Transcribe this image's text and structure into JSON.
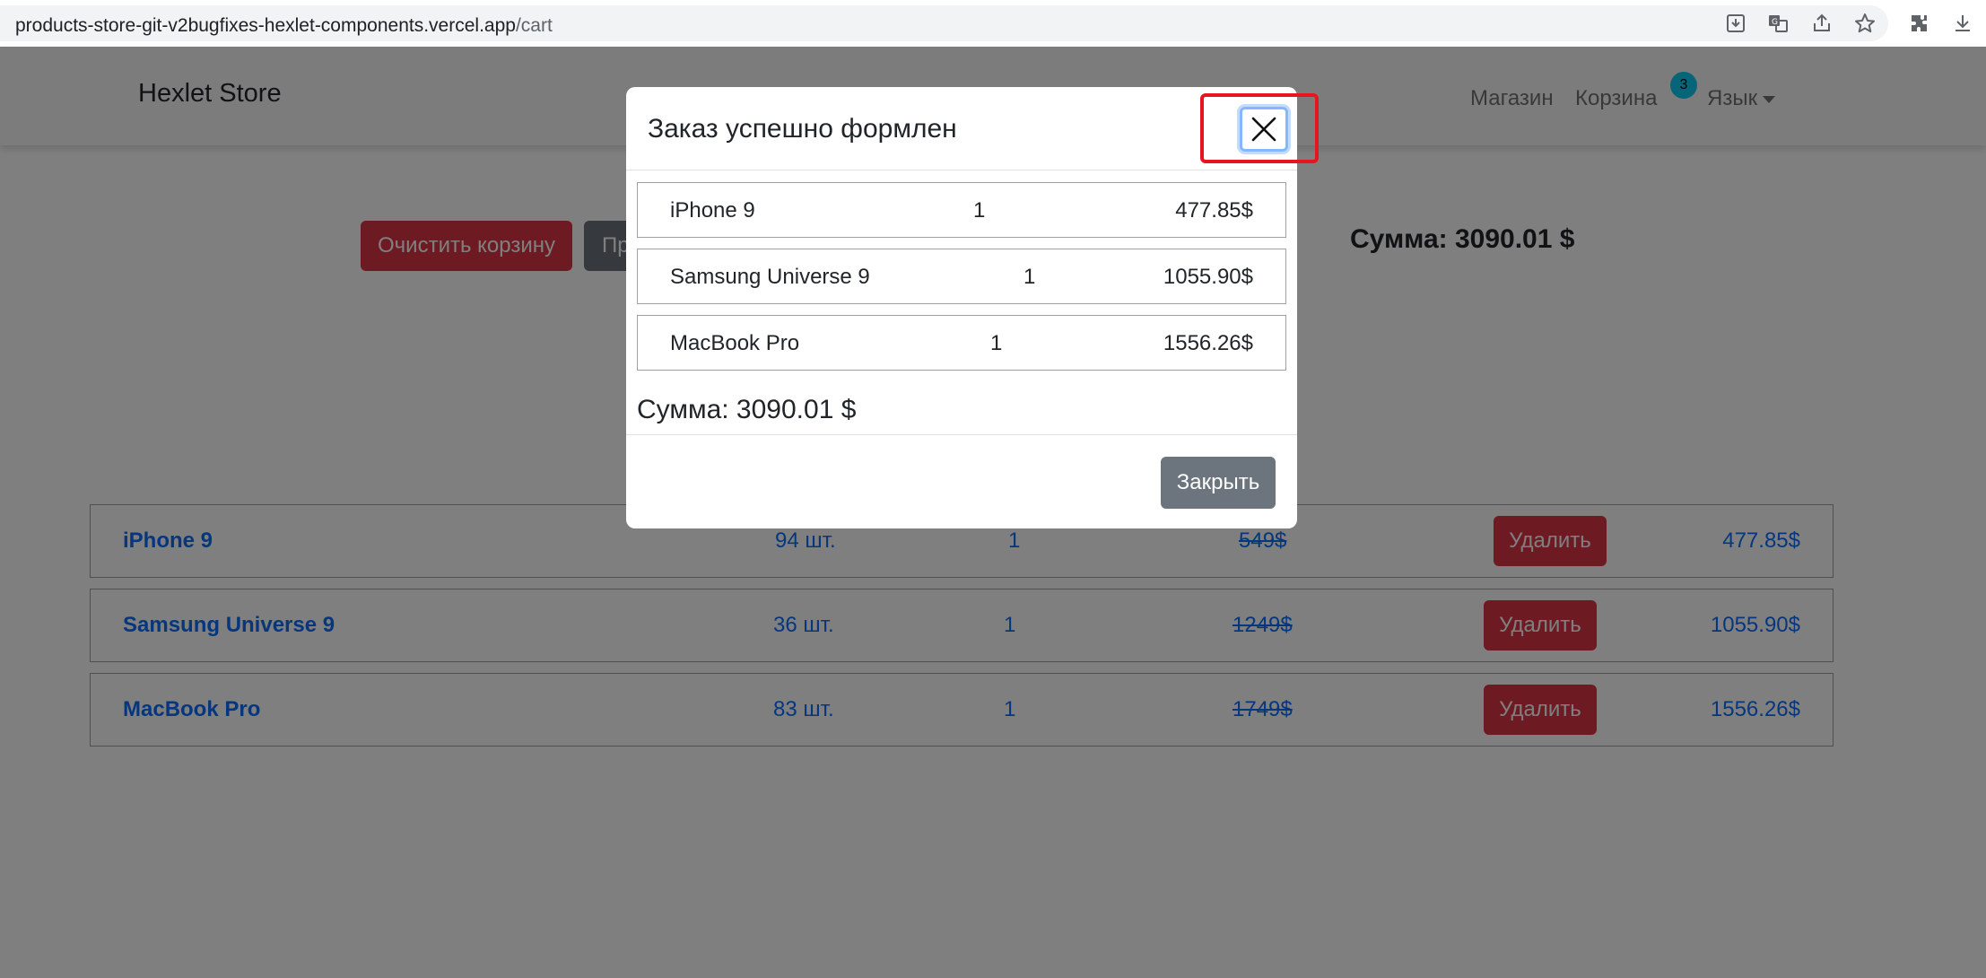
{
  "browser": {
    "url_host": "products-store-git-v2bugfixes-hexlet-components.vercel.app",
    "url_path": "/cart"
  },
  "navbar": {
    "brand": "Hexlet Store",
    "shop": "Магазин",
    "cart": "Корзина",
    "cart_count": "3",
    "language": "Язык"
  },
  "cart": {
    "clear_label": "Очистить корзину",
    "order_label_visible": "Пр",
    "total": "Сумма: 3090.01 $",
    "delete_label": "Удалить",
    "items": [
      {
        "name": "iPhone 9",
        "stock": "94 шт.",
        "qty": "1",
        "old_price": "549$",
        "price": "477.85$"
      },
      {
        "name": "Samsung Universe 9",
        "stock": "36 шт.",
        "qty": "1",
        "old_price": "1249$",
        "price": "1055.90$"
      },
      {
        "name": "MacBook Pro",
        "stock": "83 шт.",
        "qty": "1",
        "old_price": "1749$",
        "price": "1556.26$"
      }
    ]
  },
  "modal": {
    "title": "Заказ успешно формлен",
    "items": [
      {
        "name": "iPhone 9",
        "qty": "1",
        "price": "477.85$"
      },
      {
        "name": "Samsung Universe 9",
        "qty": "1",
        "price": "1055.90$"
      },
      {
        "name": "MacBook Pro",
        "qty": "1",
        "price": "1556.26$"
      }
    ],
    "total": "Сумма: 3090.01 $",
    "close_label": "Закрыть"
  },
  "colors": {
    "danger": "#dc3545",
    "secondary": "#6c757d",
    "link": "#0d6efd",
    "badge": "#0dcaf0",
    "annotation": "#e8151f"
  },
  "icons": [
    "download-icon",
    "translate-icon",
    "share-icon",
    "star-icon",
    "extensions-icon",
    "downloads-icon",
    "close-icon"
  ]
}
